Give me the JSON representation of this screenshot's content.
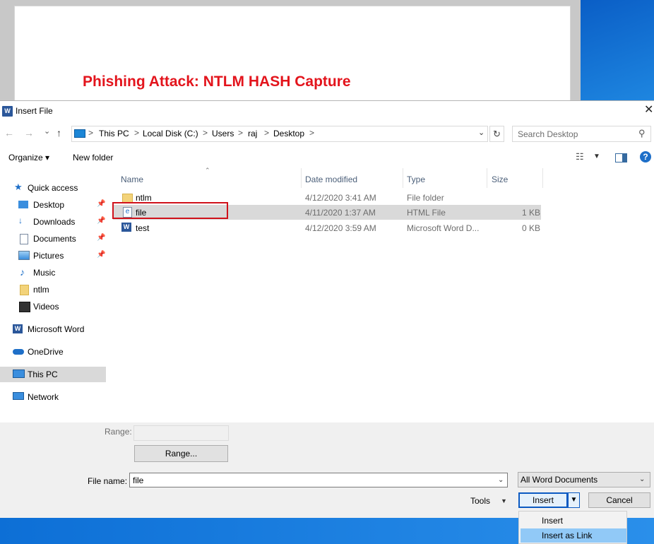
{
  "background": {
    "doc_heading": "Phishing Attack: NTLM HASH Capture",
    "heading_color": "#e3141c"
  },
  "dialog": {
    "title": "Insert File",
    "app_icon_letter": "W",
    "close_glyph": "✕"
  },
  "nav": {
    "back": "←",
    "forward": "→",
    "recent": "⌄",
    "up": "↑"
  },
  "address": {
    "crumbs": [
      "This PC",
      "Local Disk (C:)",
      "Users",
      "raj",
      "Desktop"
    ],
    "separator": ">",
    "refresh_glyph": "↻",
    "search_placeholder": "Search Desktop"
  },
  "toolbar": {
    "organize": "Organize ▾",
    "new_folder": "New folder",
    "help": "?"
  },
  "sidebar": {
    "items": [
      {
        "label": "Quick access",
        "icon": "star-icon"
      },
      {
        "label": "Desktop",
        "icon": "desktop-icon",
        "pinned": true
      },
      {
        "label": "Downloads",
        "icon": "download-icon",
        "pinned": true
      },
      {
        "label": "Documents",
        "icon": "documents-icon",
        "pinned": true
      },
      {
        "label": "Pictures",
        "icon": "pictures-icon",
        "pinned": true
      },
      {
        "label": "Music",
        "icon": "music-icon"
      },
      {
        "label": "ntlm",
        "icon": "folder-icon"
      },
      {
        "label": "Videos",
        "icon": "videos-icon"
      },
      {
        "label": "Microsoft Word",
        "icon": "word-icon"
      },
      {
        "label": "OneDrive",
        "icon": "cloud-icon"
      },
      {
        "label": "This PC",
        "icon": "computer-icon",
        "selected": true
      },
      {
        "label": "Network",
        "icon": "network-icon"
      }
    ]
  },
  "columns": {
    "name": "Name",
    "date": "Date modified",
    "type": "Type",
    "size": "Size"
  },
  "files": [
    {
      "name": "ntlm",
      "date": "4/12/2020 3:41 AM",
      "type": "File folder",
      "size": "",
      "icon": "folder-icon"
    },
    {
      "name": "file",
      "date": "4/11/2020 1:37 AM",
      "type": "HTML File",
      "size": "1 KB",
      "icon": "html-file-icon",
      "selected": true
    },
    {
      "name": "test",
      "date": "4/12/2020 3:59 AM",
      "type": "Microsoft Word D...",
      "size": "0 KB",
      "icon": "word-doc-icon"
    }
  ],
  "bottom": {
    "range_label": "Range:",
    "range_button": "Range...",
    "file_name_label": "File name:",
    "file_name_value": "file",
    "filter_value": "All Word Documents",
    "tools": "Tools",
    "insert": "Insert",
    "cancel": "Cancel"
  },
  "insert_menu": {
    "items": [
      "Insert",
      "Insert as Link"
    ],
    "highlighted": "Insert as Link"
  }
}
